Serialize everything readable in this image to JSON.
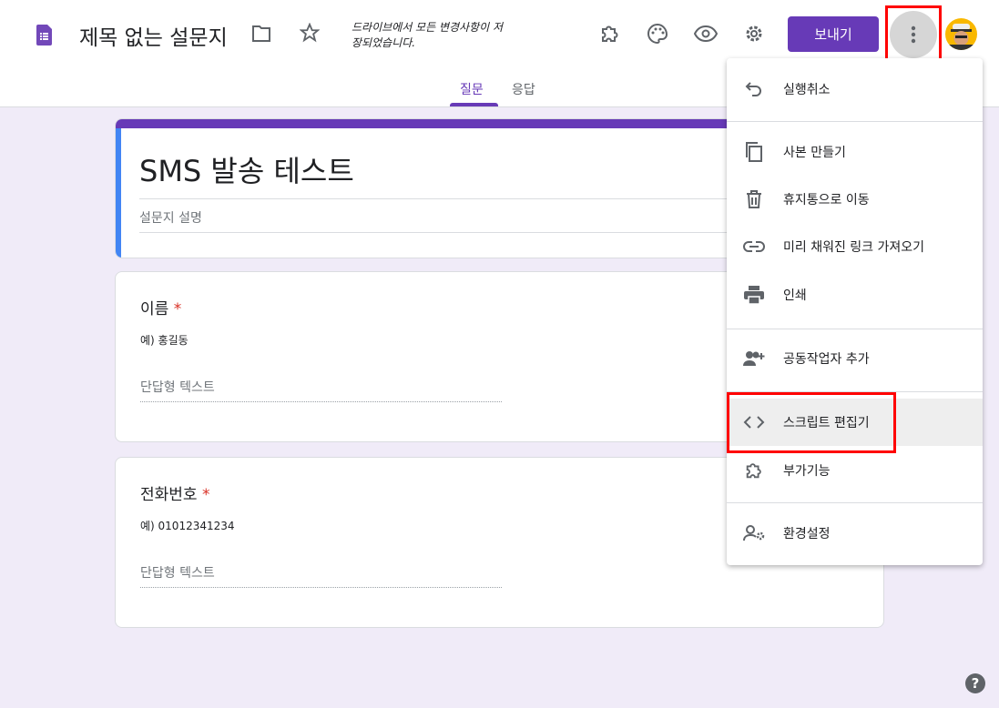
{
  "header": {
    "title": "제목 없는 설문지",
    "save_status": "드라이브에서 모든 변경사항이 저장되었습니다.",
    "send_label": "보내기"
  },
  "tabs": [
    {
      "label": "질문",
      "active": true
    },
    {
      "label": "응답",
      "active": false
    }
  ],
  "form": {
    "title": "SMS 발송 테스트",
    "description_placeholder": "설문지 설명"
  },
  "questions": [
    {
      "title": "이름",
      "required": "*",
      "description": "예) 홍길동",
      "answer_placeholder": "단답형 텍스트"
    },
    {
      "title": "전화번호",
      "required": "*",
      "description": "예) 01012341234",
      "answer_placeholder": "단답형 텍스트"
    }
  ],
  "menu": {
    "items": [
      {
        "label": "실행취소",
        "icon": "undo-icon"
      },
      {
        "label": "사본 만들기",
        "icon": "copy-icon"
      },
      {
        "label": "휴지통으로 이동",
        "icon": "trash-icon"
      },
      {
        "label": "미리 채워진 링크 가져오기",
        "icon": "link-icon"
      },
      {
        "label": "인쇄",
        "icon": "print-icon"
      },
      {
        "label": "공동작업자 추가",
        "icon": "add-people-icon"
      },
      {
        "label": "스크립트 편집기",
        "icon": "code-icon",
        "highlighted": true
      },
      {
        "label": "부가기능",
        "icon": "puzzle-icon"
      },
      {
        "label": "환경설정",
        "icon": "person-settings-icon"
      }
    ]
  },
  "colors": {
    "accent": "#673ab7",
    "background": "#f0ebf8",
    "highlight": "#ff0000"
  }
}
